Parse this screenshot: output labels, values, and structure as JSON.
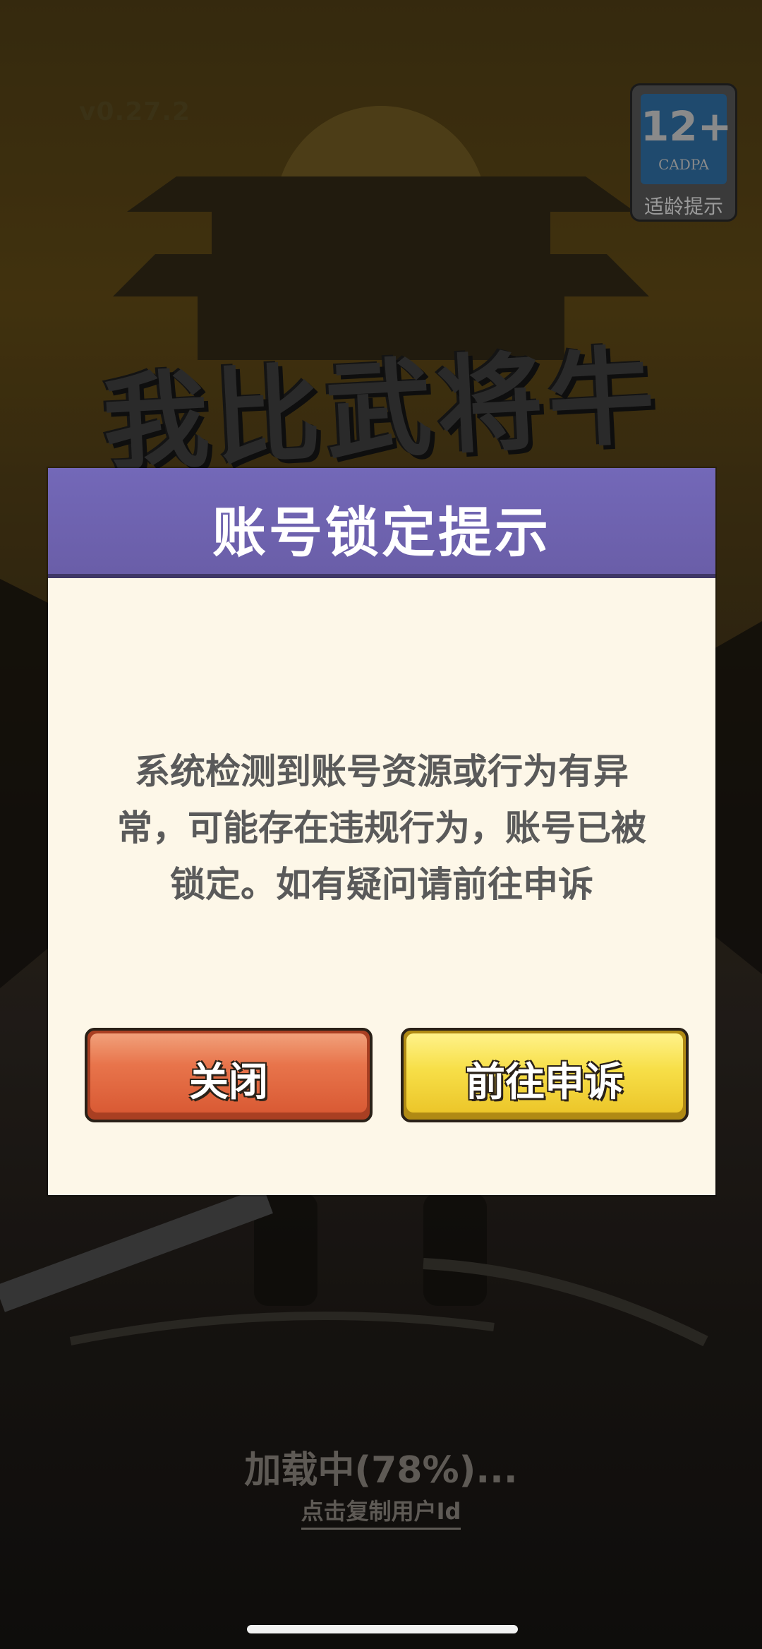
{
  "header": {
    "version": "v0.27.2",
    "age_rating": {
      "number": "12+",
      "org": "CADPA",
      "label": "适龄提示"
    },
    "game_title": "我比武将牛"
  },
  "dialog": {
    "title": "账号锁定提示",
    "message": "系统检测到账号资源或行为有异常，可能存在违规行为，账号已被锁定。如有疑问请前往申诉",
    "buttons": {
      "close_label": "关闭",
      "appeal_label": "前往申诉"
    }
  },
  "footer": {
    "loading_text": "加载中(78%)...",
    "loading_progress_percent": 78,
    "copy_user_id_label": "点击复制用户Id"
  },
  "colors": {
    "dialog_header": "#6a5ea8",
    "dialog_body": "#fdf7e8",
    "close_button": "#e8744b",
    "appeal_button": "#f7df48"
  }
}
